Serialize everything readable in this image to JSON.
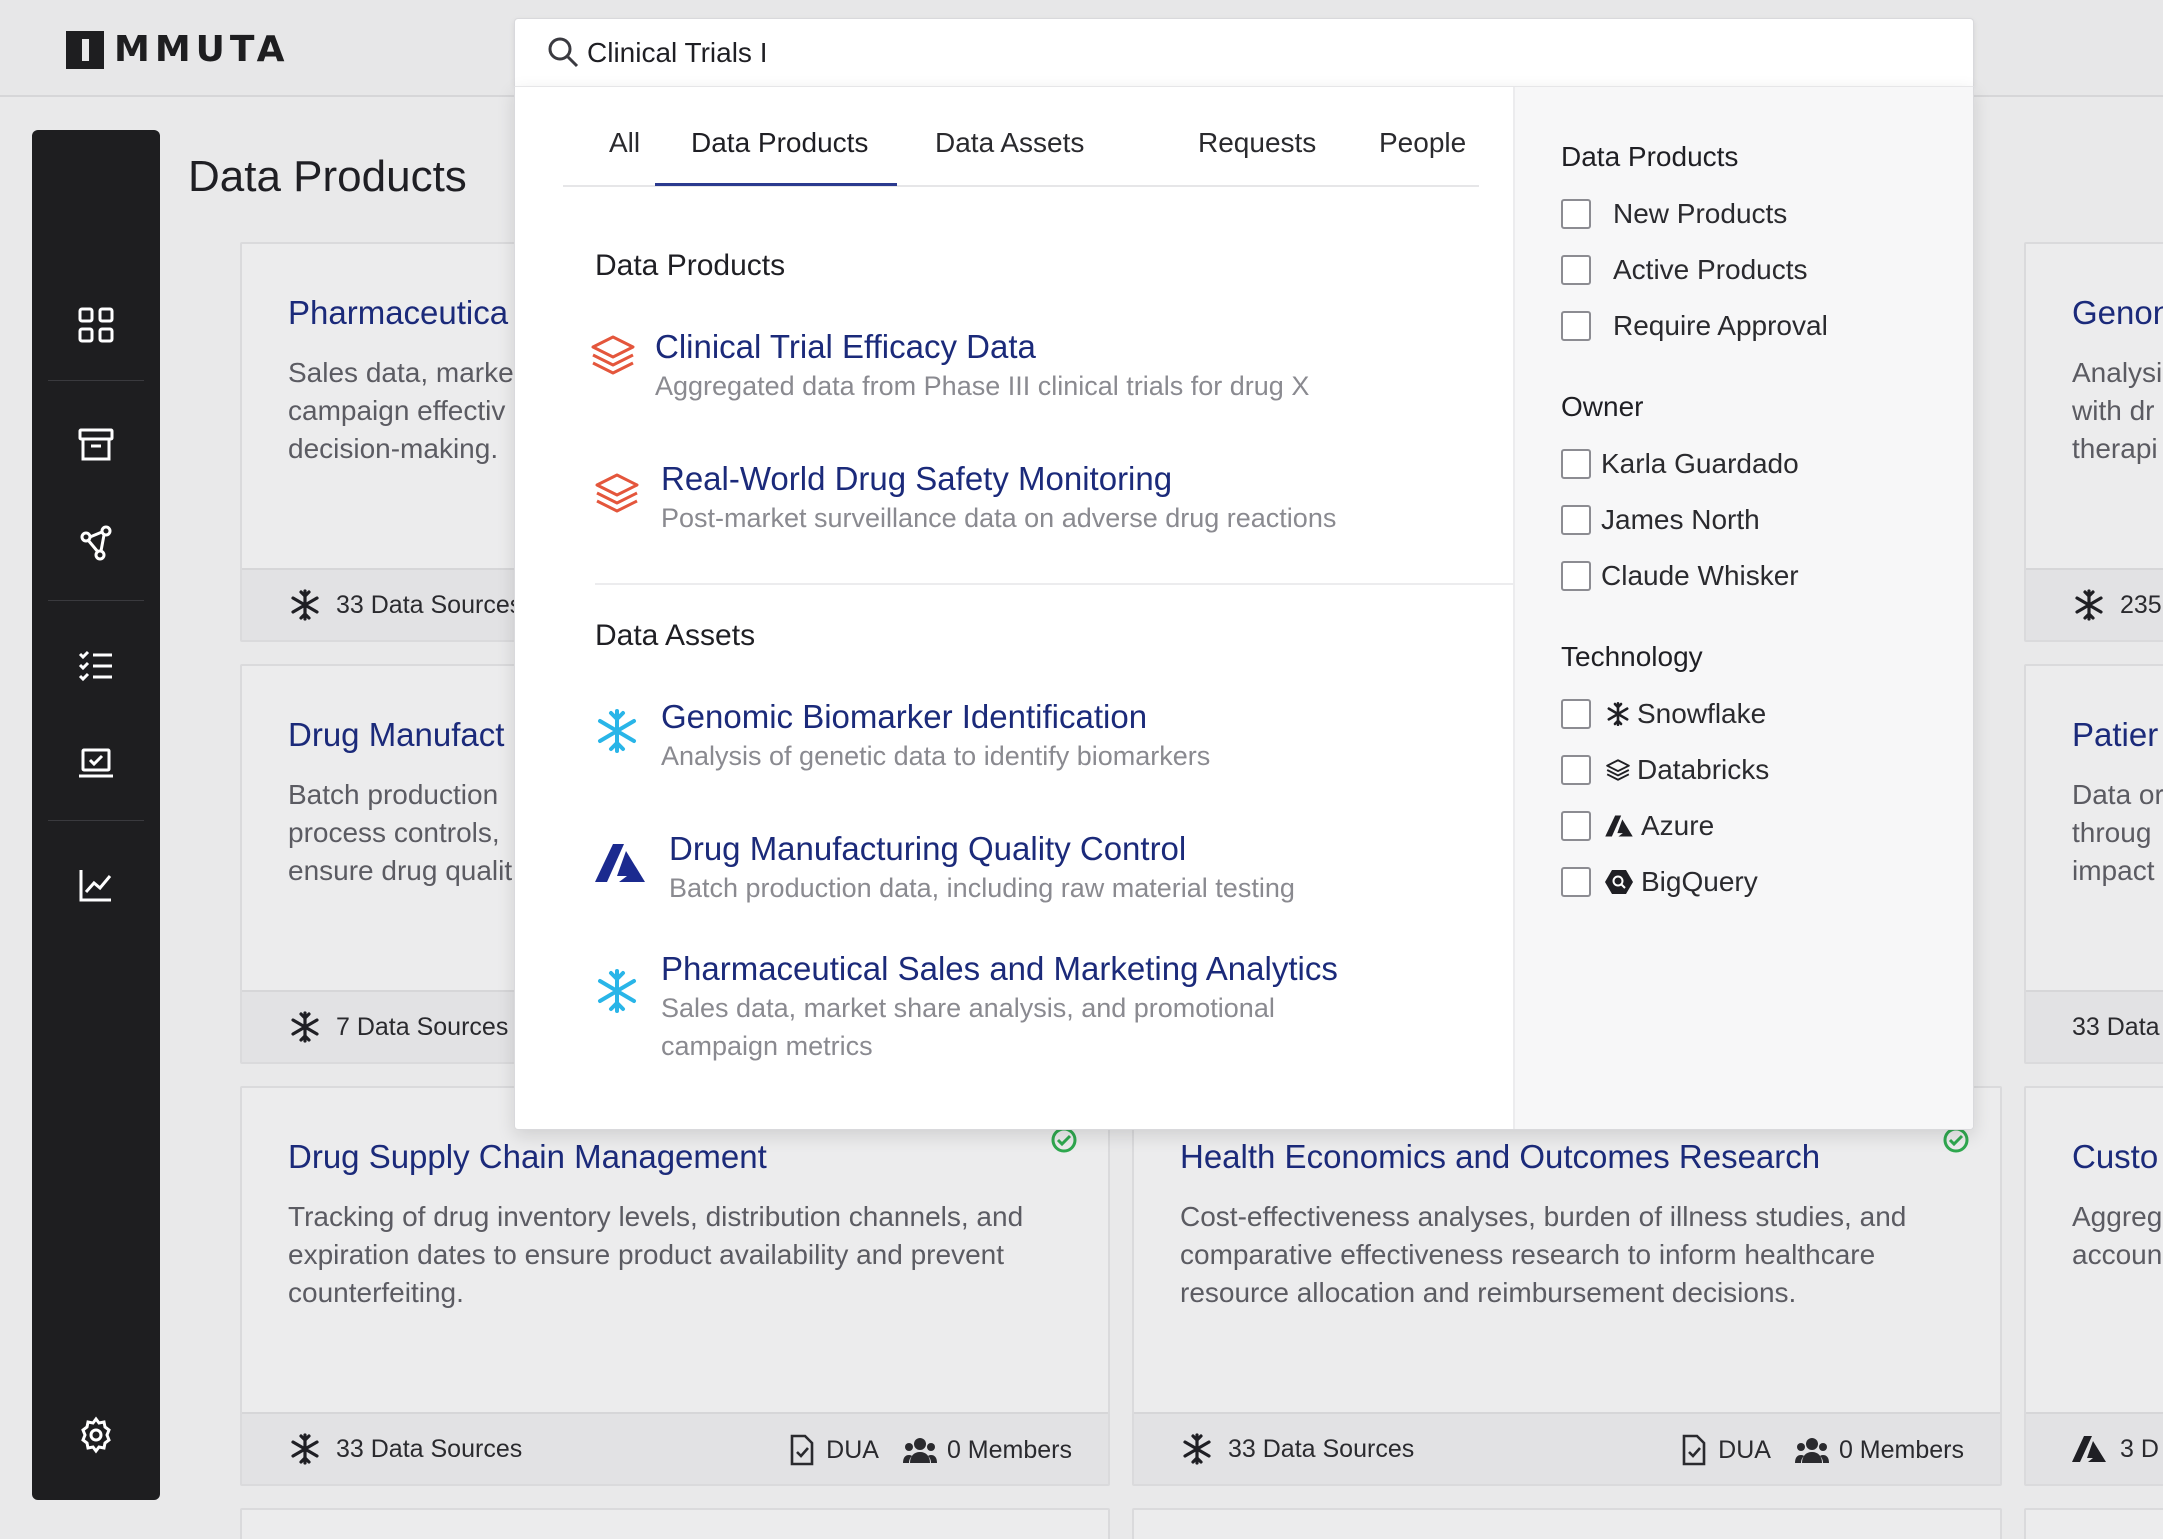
{
  "app": {
    "logo_text": "MMUTA",
    "page_title": "Data Products"
  },
  "search": {
    "value": "Clinical Trials I",
    "placeholder": ""
  },
  "tabs": [
    {
      "label": "All"
    },
    {
      "label": "Data Products",
      "active": true
    },
    {
      "label": "Data Assets"
    },
    {
      "label": "Requests"
    },
    {
      "label": "People"
    }
  ],
  "results": {
    "data_products_heading": "Data Products",
    "data_products": [
      {
        "title": "Clinical Trial Efficacy Data",
        "desc": "Aggregated data from Phase III clinical trials for drug X",
        "icon": "databricks-icon"
      },
      {
        "title": "Real-World Drug Safety Monitoring",
        "desc": "Post-market surveillance data on adverse drug reactions",
        "icon": "databricks-icon"
      }
    ],
    "data_assets_heading": "Data Assets",
    "data_assets": [
      {
        "title": "Genomic Biomarker Identification",
        "desc": "Analysis of genetic data to identify biomarkers",
        "icon": "snowflake-icon"
      },
      {
        "title": "Drug Manufacturing Quality Control",
        "desc": "Batch production data, including raw material testing",
        "icon": "azure-icon"
      },
      {
        "title": "Pharmaceutical Sales and Marketing Analytics",
        "desc": "Sales data, market share analysis, and promotional campaign metrics",
        "icon": "snowflake-icon"
      }
    ]
  },
  "filters": {
    "products_heading": "Data Products",
    "products": [
      "New Products",
      "Active Products",
      "Require Approval"
    ],
    "owner_heading": "Owner",
    "owners": [
      "Karla Guardado",
      "James North",
      "Claude Whisker"
    ],
    "technology_heading": "Technology",
    "technologies": [
      {
        "label": "Snowflake",
        "icon": "snowflake-icon"
      },
      {
        "label": "Databricks",
        "icon": "databricks-icon"
      },
      {
        "label": "Azure",
        "icon": "azure-icon"
      },
      {
        "label": "BigQuery",
        "icon": "bigquery-icon"
      }
    ]
  },
  "cards": {
    "c1": {
      "title": "Pharmaceutica",
      "desc": "Sales data, marke\ncampaign effectiv\ndecision-making.",
      "sources": "33 Data Sources"
    },
    "c2": {
      "title": "Drug Manufact",
      "desc": "Batch production\nprocess controls,\nensure drug qualit",
      "sources": "7 Data Sources"
    },
    "c3": {
      "title": "Drug Supply Chain Management",
      "desc": "Tracking of drug inventory levels, distribution channels, and expiration dates to ensure product availability and prevent counterfeiting.",
      "sources": "33 Data Sources",
      "dua": "DUA",
      "members": "0 Members"
    },
    "c4": {
      "title": "Health Economics and Outcomes Research",
      "desc": "Cost-effectiveness analyses, burden of illness studies, and comparative effectiveness research to inform healthcare resource allocation and reimbursement decisions.",
      "sources": "33 Data Sources",
      "dua": "DUA",
      "members": "0 Members"
    },
    "r1": {
      "title": "Genon",
      "desc": "Analysi\nwith dr\ntherapi",
      "sources": "235"
    },
    "r2": {
      "title": "Patier",
      "desc": "Data or\nthroug\nimpact",
      "sources": "33 Data"
    },
    "r3": {
      "title": "Custo",
      "desc": "Aggreg\naccoun",
      "sources": "3 D"
    }
  },
  "colors": {
    "accent": "#1b2a7a",
    "sidebar": "#1e1e20",
    "verified": "#2fa84f",
    "databricks": "#e4563c",
    "snowflake": "#29b5e8",
    "azure": "#1b2a8f"
  }
}
